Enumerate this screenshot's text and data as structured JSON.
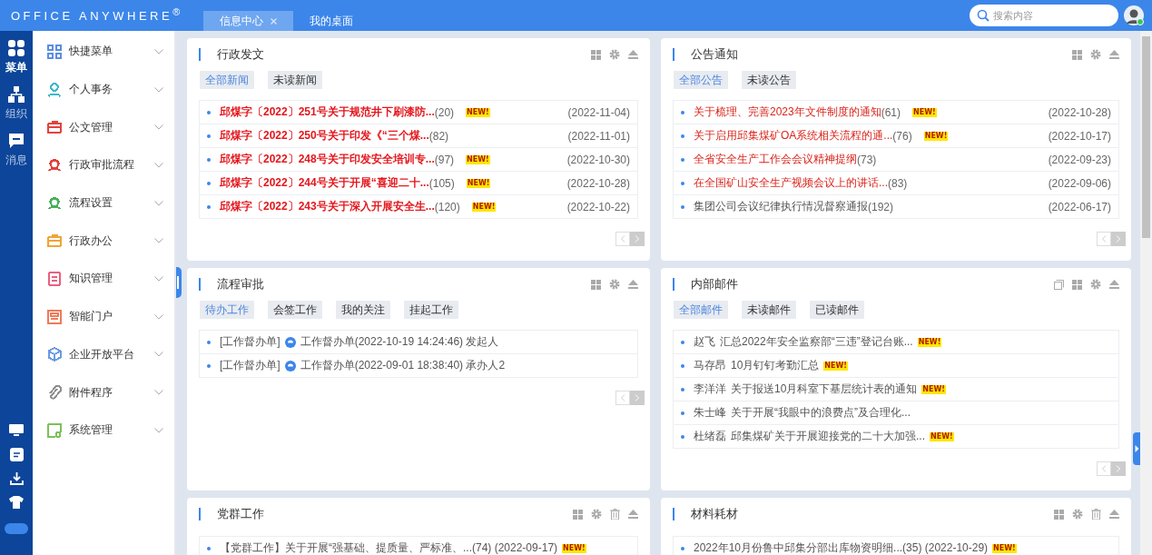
{
  "header": {
    "logo": "OFFICE ANYWHERE$^{®}$",
    "tabs": [
      {
        "label": "信息中心",
        "selected": true,
        "closable": true
      },
      {
        "label": "我的桌面",
        "selected": false,
        "closable": false
      }
    ],
    "search": {
      "placeholder": "搜索内容"
    }
  },
  "rail": {
    "items": [
      {
        "label": "菜单",
        "selected": true
      },
      {
        "label": "组织",
        "selected": false
      },
      {
        "label": "消息",
        "selected": false
      }
    ]
  },
  "sidebar": {
    "items": [
      {
        "label": "快捷菜单",
        "color": "#5b8de0"
      },
      {
        "label": "个人事务",
        "color": "#3fb8c8"
      },
      {
        "label": "公文管理",
        "color": "#e0443c"
      },
      {
        "label": "行政审批流程",
        "color": "#e0443c"
      },
      {
        "label": "流程设置",
        "color": "#47b05a"
      },
      {
        "label": "行政办公",
        "color": "#f0a436"
      },
      {
        "label": "知识管理",
        "color": "#e8607e"
      },
      {
        "label": "智能门户",
        "color": "#ef7a5a"
      },
      {
        "label": "企业开放平台",
        "color": "#6c9be0"
      },
      {
        "label": "附件程序",
        "color": "#909090"
      },
      {
        "label": "系统管理",
        "color": "#7cc05a"
      }
    ]
  },
  "cards": [
    {
      "title": "行政发文",
      "actions": [
        {
          "kind": "grid"
        },
        {
          "kind": "gear"
        },
        {
          "kind": "collapse"
        }
      ],
      "filters": [
        {
          "label": "全部新闻",
          "selected": true
        },
        {
          "label": "未读新闻",
          "selected": false
        }
      ],
      "pager": true,
      "rows": [
        {
          "kind": "news",
          "bold": true,
          "highlight": true,
          "text": "邱煤字〔2022〕251号关于规范井下刷漆防...",
          "count": "(20)",
          "badge": "NEW!",
          "date": "(2022-11-04)"
        },
        {
          "kind": "news",
          "bold": true,
          "highlight": true,
          "text": "邱煤字〔2022〕250号关于印发《“三个煤...",
          "count": "(82)",
          "date": "(2022-11-01)"
        },
        {
          "kind": "news",
          "bold": true,
          "highlight": true,
          "text": "邱煤字〔2022〕248号关于印发安全培训专...",
          "count": "(97)",
          "badge": "NEW!",
          "date": "(2022-10-30)"
        },
        {
          "kind": "news",
          "bold": true,
          "highlight": true,
          "text": "邱煤字〔2022〕244号关于开展“喜迎二十...",
          "count": "(105)",
          "badge": "NEW!",
          "date": "(2022-10-28)"
        },
        {
          "kind": "news",
          "bold": true,
          "highlight": true,
          "text": "邱煤字〔2022〕243号关于深入开展安全生...",
          "count": "(120)",
          "badge": "NEW!",
          "date": "(2022-10-22)"
        }
      ]
    },
    {
      "title": "公告通知",
      "actions": [
        {
          "kind": "grid"
        },
        {
          "kind": "gear"
        },
        {
          "kind": "collapse"
        }
      ],
      "filters": [
        {
          "label": "全部公告",
          "selected": true
        },
        {
          "label": "未读公告",
          "selected": false
        }
      ],
      "pager": true,
      "rows": [
        {
          "kind": "news",
          "bold": false,
          "highlight": true,
          "text": "关于梳理、完善2023年文件制度的通知",
          "count": "(61)",
          "badge": "NEW!",
          "date": "(2022-10-28)"
        },
        {
          "kind": "news",
          "bold": false,
          "highlight": true,
          "text": "关于启用邱集煤矿OA系统相关流程的通...",
          "count": "(76)",
          "badge": "NEW!",
          "date": "(2022-10-17)"
        },
        {
          "kind": "news",
          "bold": false,
          "highlight": true,
          "text": "全省安全生产工作会会议精神提纲",
          "count": "(73)",
          "date": "(2022-09-23)"
        },
        {
          "kind": "news",
          "bold": false,
          "highlight": true,
          "text": "在全国矿山安全生产视频会议上的讲话...",
          "count": "(83)",
          "date": "(2022-09-06)"
        },
        {
          "kind": "news",
          "bold": false,
          "highlight": false,
          "text": "集团公司会议纪律执行情况督察通报",
          "count": "(192)",
          "date": "(2022-06-17)"
        }
      ]
    },
    {
      "title": "流程审批",
      "actions": [
        {
          "kind": "grid"
        },
        {
          "kind": "gear"
        },
        {
          "kind": "collapse"
        }
      ],
      "filters": [
        {
          "label": "待办工作",
          "selected": true
        },
        {
          "label": "会签工作",
          "selected": false
        },
        {
          "label": "我的关注",
          "selected": false
        },
        {
          "label": "挂起工作",
          "selected": false
        }
      ],
      "pager": true,
      "rows": [
        {
          "kind": "flow",
          "tag": "[工作督办单]",
          "text": "工作督办单(2022-10-19 14:24:46) 发起人"
        },
        {
          "kind": "flow",
          "tag": "[工作督办单]",
          "text": "工作督办单(2022-09-01 18:38:40) 承办人2"
        }
      ]
    },
    {
      "title": "内部邮件",
      "actions": [
        {
          "kind": "copy"
        },
        {
          "kind": "grid"
        },
        {
          "kind": "gear"
        },
        {
          "kind": "collapse"
        }
      ],
      "filters": [
        {
          "label": "全部邮件",
          "selected": true
        },
        {
          "label": "未读邮件",
          "selected": false
        },
        {
          "label": "已读邮件",
          "selected": false
        }
      ],
      "pager": true,
      "rows": [
        {
          "kind": "mail",
          "sender": "赵飞",
          "text": "汇总2022年安全监察部“三违”登记台账...",
          "badge": "NEW!"
        },
        {
          "kind": "mail",
          "sender": "马存昂",
          "text": "10月钉钉考勤汇总",
          "badge": "NEW!"
        },
        {
          "kind": "mail",
          "sender": "李洋洋",
          "text": "关于报送10月科室下基层统计表的通知",
          "badge": "NEW!"
        },
        {
          "kind": "mail",
          "sender": "朱士峰",
          "text": "关于开展“我眼中的浪费点”及合理化..."
        },
        {
          "kind": "mail",
          "sender": "杜绪磊",
          "text": "邱集煤矿关于开展迎接党的二十大加强...",
          "badge": "NEW!"
        }
      ]
    },
    {
      "title": "党群工作",
      "actions": [
        {
          "kind": "grid"
        },
        {
          "kind": "gear"
        },
        {
          "kind": "trash"
        },
        {
          "kind": "collapse"
        }
      ],
      "pager": false,
      "rows": [
        {
          "kind": "line",
          "text": "【党群工作】关于开展“强基础、提质量、严标准、...(74) (2022-09-17)",
          "badge": "NEW!"
        }
      ]
    },
    {
      "title": "材料耗材",
      "actions": [
        {
          "kind": "grid"
        },
        {
          "kind": "gear"
        },
        {
          "kind": "trash"
        },
        {
          "kind": "collapse"
        }
      ],
      "pager": false,
      "rows": [
        {
          "kind": "line",
          "text": "2022年10月份鲁中邱集分部出库物资明细...(35) (2022-10-29)",
          "badge": "NEW!"
        }
      ]
    }
  ]
}
